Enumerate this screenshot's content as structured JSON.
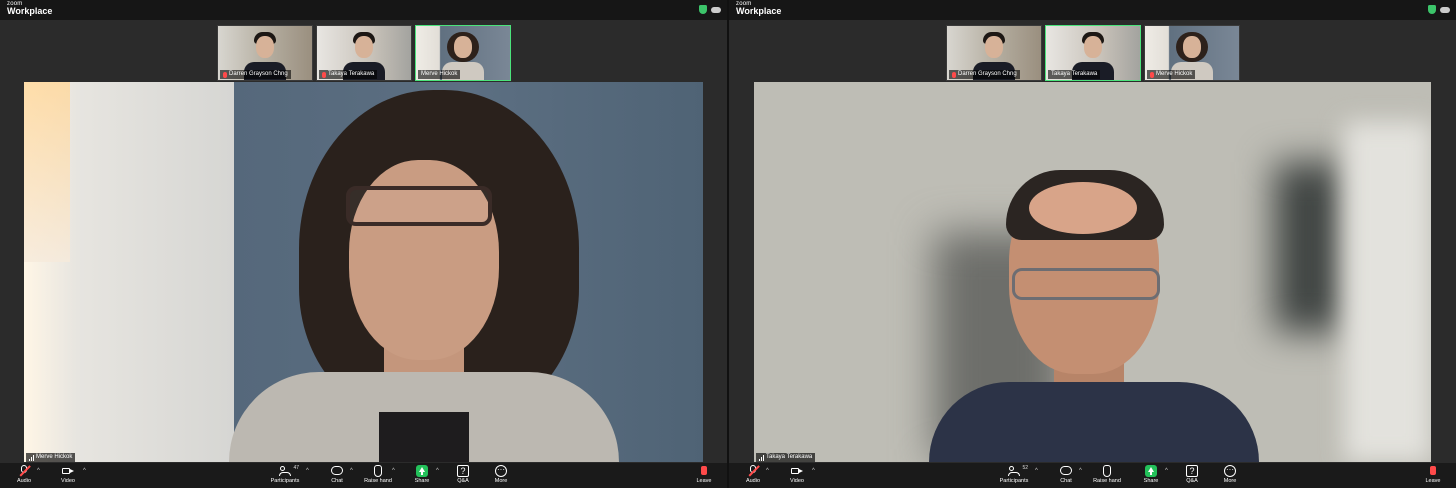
{
  "windows": [
    {
      "logo_small": "zoom",
      "logo_main": "Workplace",
      "thumbnails": [
        {
          "name": "Darren Grayson Chng",
          "muted": true,
          "active": false
        },
        {
          "name": "Takaya Terakawa",
          "muted": true,
          "active": false
        },
        {
          "name": "Merve Hickok",
          "muted": false,
          "active": true
        }
      ],
      "speaker_name": "Merve Hickok",
      "toolbar": {
        "audio": "Audio",
        "video": "Video",
        "participants": "Participants",
        "participants_count": "47",
        "chat": "Chat",
        "raise_hand": "Raise hand",
        "share": "Share",
        "qa": "Q&A",
        "more": "More",
        "leave": "Leave"
      }
    },
    {
      "logo_small": "zoom",
      "logo_main": "Workplace",
      "thumbnails": [
        {
          "name": "Darren Grayson Chng",
          "muted": true,
          "active": false
        },
        {
          "name": "Takaya Terakawa",
          "muted": false,
          "active": true
        },
        {
          "name": "Merve Hickok",
          "muted": true,
          "active": false
        }
      ],
      "speaker_name": "Takaya Terakawa",
      "toolbar": {
        "audio": "Audio",
        "video": "Video",
        "participants": "Participants",
        "participants_count": "52",
        "chat": "Chat",
        "raise_hand": "Raise hand",
        "share": "Share",
        "qa": "Q&A",
        "more": "More",
        "leave": "Leave"
      }
    }
  ],
  "colors": {
    "active_border": "#4be37b",
    "muted_red": "#ff4a4a",
    "share_green": "#23c15a"
  }
}
